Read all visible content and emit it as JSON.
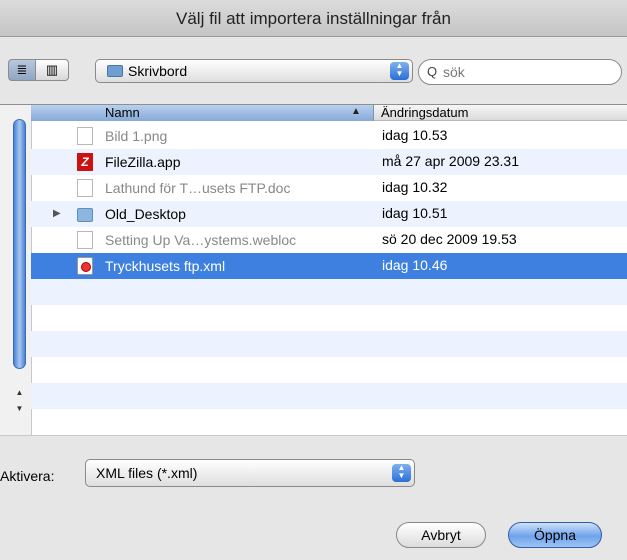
{
  "dialog": {
    "title": "Välj fil att importera inställningar från"
  },
  "toolbar": {
    "list_view_icon": "≣",
    "column_view_icon": "▥",
    "location": "Skrivbord",
    "search_placeholder": "sök",
    "search_icon": "Q"
  },
  "columns": {
    "name": "Namn",
    "date": "Ändringsdatum",
    "sort_indicator": "▲"
  },
  "files": [
    {
      "name": "Bild 1.png",
      "date": "idag 10.53",
      "icon": "image-file-icon",
      "enabled": false,
      "expander": ""
    },
    {
      "name": "FileZilla.app",
      "date": "må 27 apr 2009 23.31",
      "icon": "filezilla-app-icon",
      "enabled": true,
      "expander": ""
    },
    {
      "name": "Lathund för T…usets FTP.doc",
      "date": "idag 10.32",
      "icon": "document-file-icon",
      "enabled": false,
      "expander": ""
    },
    {
      "name": "Old_Desktop",
      "date": "idag 10.51",
      "icon": "folder-icon",
      "enabled": true,
      "expander": "▶"
    },
    {
      "name": "Setting Up Va…ystems.webloc",
      "date": "sö 20 dec 2009 19.53",
      "icon": "webloc-file-icon",
      "enabled": false,
      "expander": ""
    },
    {
      "name": "Tryckhusets ftp.xml",
      "date": "idag 10.46",
      "icon": "xml-file-icon",
      "enabled": true,
      "expander": ""
    }
  ],
  "selected_index": 5,
  "scrollbar": {
    "up_arrow": "▲",
    "down_arrow": "▼"
  },
  "filter": {
    "label": "Aktivera:",
    "value": "XML files (*.xml)"
  },
  "buttons": {
    "cancel": "Avbryt",
    "open": "Öppna"
  },
  "colors": {
    "selection": "#3d80df",
    "alt_row": "#edf3fe",
    "header_active": "#9dbbe4"
  }
}
